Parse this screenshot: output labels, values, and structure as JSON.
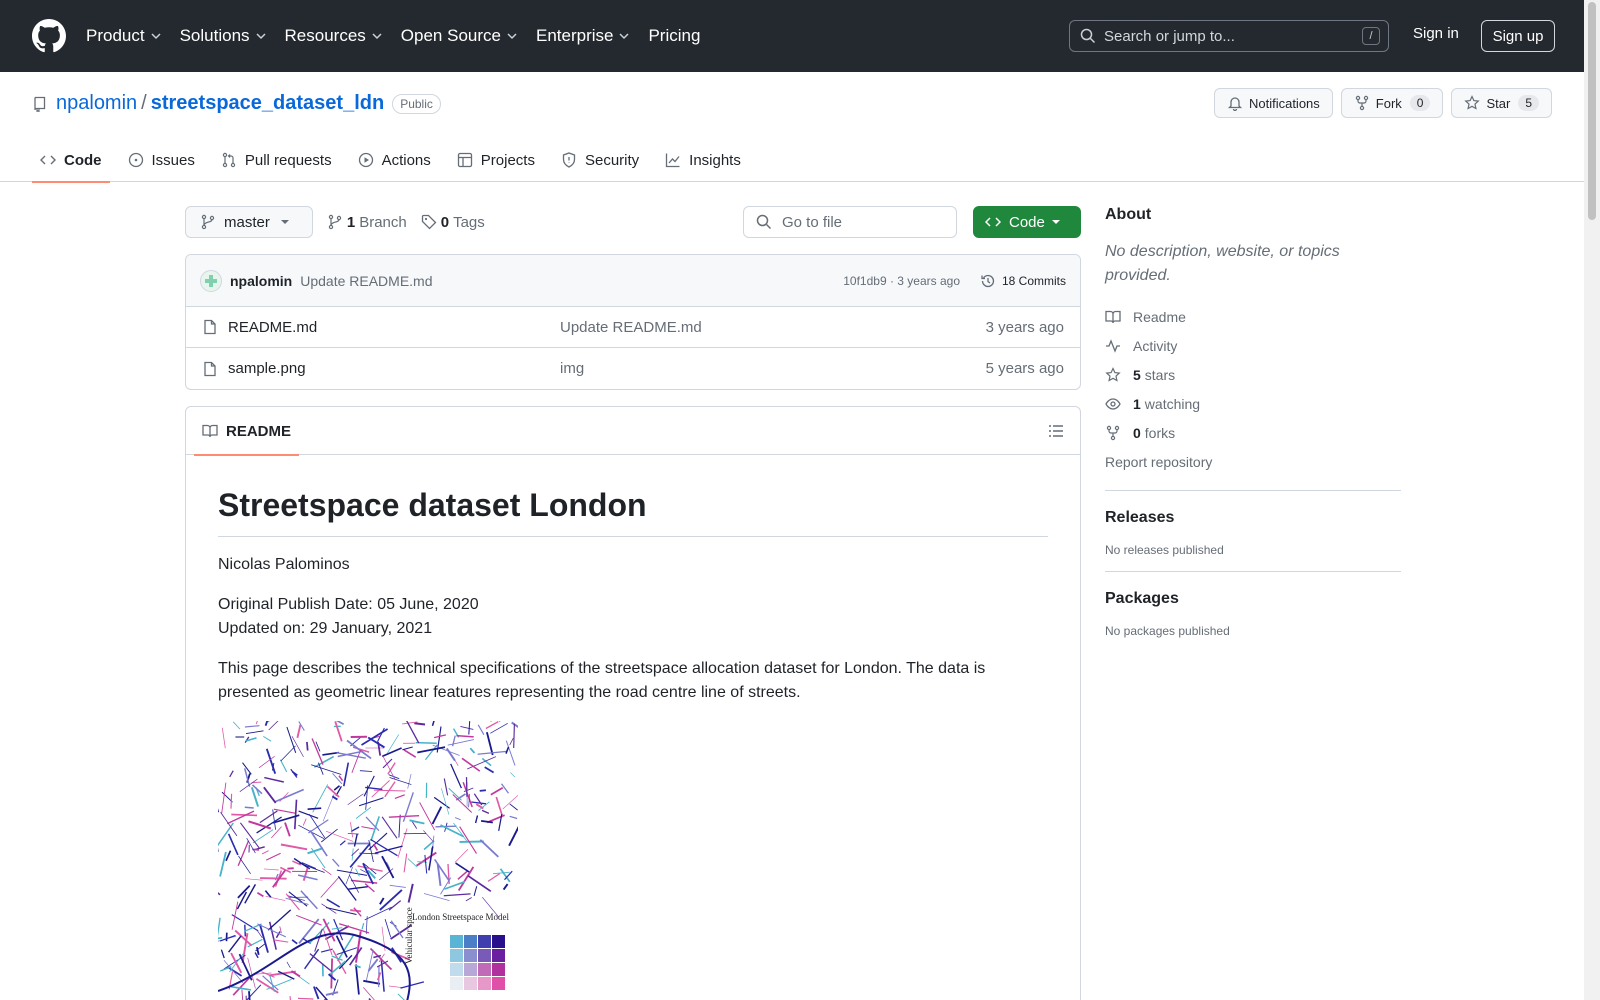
{
  "topnav": {
    "items": [
      "Product",
      "Solutions",
      "Resources",
      "Open Source",
      "Enterprise",
      "Pricing"
    ],
    "search_placeholder": "Search or jump to...",
    "search_shortcut": "/",
    "sign_in": "Sign in",
    "sign_up": "Sign up"
  },
  "repo": {
    "owner": "npalomin",
    "separator": "/",
    "name": "streetspace_dataset_ldn",
    "visibility": "Public",
    "notifications_label": "Notifications",
    "fork_label": "Fork",
    "fork_count": "0",
    "star_label": "Star",
    "star_count": "5"
  },
  "tabs": [
    "Code",
    "Issues",
    "Pull requests",
    "Actions",
    "Projects",
    "Security",
    "Insights"
  ],
  "toolbar": {
    "branch": "master",
    "branch_count": "1",
    "branch_label": "Branch",
    "tag_count": "0",
    "tag_label": "Tags",
    "goto_placeholder": "Go to file",
    "code_button": "Code"
  },
  "latest_commit": {
    "author": "npalomin",
    "message": "Update README.md",
    "meta": "10f1db9 · 3 years ago",
    "commits": "18 Commits"
  },
  "files": [
    {
      "name": "README.md",
      "message": "Update README.md",
      "date": "3 years ago"
    },
    {
      "name": "sample.png",
      "message": "img",
      "date": "5 years ago"
    }
  ],
  "readme": {
    "tab": "README",
    "title": "Streetspace dataset London",
    "author": "Nicolas Palominos",
    "publish_date": "Original Publish Date: 05 June, 2020",
    "updated": "Updated on: 29 January, 2021",
    "description": "This page describes the technical specifications of the streetspace allocation dataset for London. The data is presented as geometric linear features representing the road centre line of streets.",
    "image_legend_title": "London Streetspace Model",
    "image_legend_axis": "Vehicular space"
  },
  "sidebar": {
    "about_title": "About",
    "about_desc": "No description, website, or topics provided.",
    "readme": "Readme",
    "activity": "Activity",
    "stars_count": "5",
    "stars_label": "stars",
    "watching_count": "1",
    "watching_label": "watching",
    "forks_count": "0",
    "forks_label": "forks",
    "report": "Report repository",
    "releases_title": "Releases",
    "releases_text": "No releases published",
    "packages_title": "Packages",
    "packages_text": "No packages published"
  },
  "colors": {
    "header_bg": "#24292f",
    "link": "#0969da",
    "code_button": "#1f883d",
    "active_tab": "#fd8c73"
  }
}
